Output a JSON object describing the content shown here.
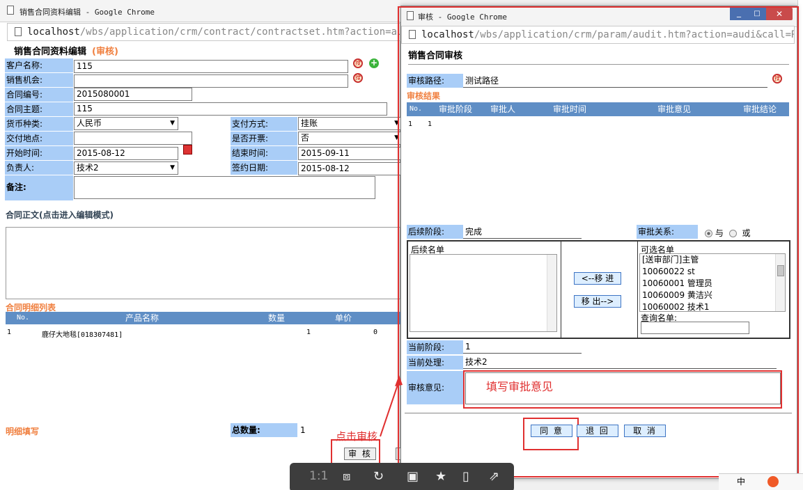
{
  "left_window": {
    "title": "销售合同资料编辑 - Google Chrome",
    "address": "localhost/wbs/application/crm/contract/contractset.htm?action=audi&",
    "address_domain": "localhost",
    "address_path": "/wbs/application/crm/contract/contractset.htm?action=audi&",
    "page_title": "销售合同资料编辑",
    "page_tag": "(审核)",
    "fields": {
      "customer_label": "客户名称:",
      "customer_value": "115",
      "opportunity_label": "销售机会:",
      "opportunity_value": "",
      "contract_no_label": "合同编号:",
      "contract_no_value": "2015080001",
      "subject_label": "合同主题:",
      "subject_value": "115",
      "currency_label": "货币种类:",
      "currency_value": "人民币",
      "payment_label": "支付方式:",
      "payment_value": "挂账",
      "delivery_label": "交付地点:",
      "delivery_value": "",
      "invoice_label": "是否开票:",
      "invoice_value": "否",
      "start_label": "开始时间:",
      "start_value": "2015-08-12",
      "end_label": "结束时间:",
      "end_value": "2015-09-11",
      "owner_label": "负责人:",
      "owner_value": "技术2",
      "sign_label": "签约日期:",
      "sign_value": "2015-08-12",
      "remark_label": "备注:",
      "remark_value": ""
    },
    "body_section": "合同正文(点击进入编辑模式)",
    "detail_section": "合同明细列表",
    "detail_columns": [
      "No.",
      "产品名称",
      "数量",
      "单价"
    ],
    "detail_rows": [
      [
        "1",
        "鹿仔大地毯[018307481]",
        "1",
        "0"
      ]
    ],
    "detail_fill_label": "明细填写",
    "total_qty_label": "总数量:",
    "total_qty_value": "1",
    "audit_button": "审 核",
    "annotation_click": "点击审核"
  },
  "right_window": {
    "title": "审核 - Google Chrome",
    "address_domain": "localhost",
    "address_path": "/wbs/application/crm/param/audit.htm?action=audi&call=Rout",
    "page_title": "销售合同审核",
    "audit_path_label": "审核路径:",
    "audit_path_value": "测试路径",
    "result_section": "审核结果",
    "result_columns": [
      "No.",
      "审批阶段",
      "审批人",
      "审批时间",
      "审批意见",
      "审批结论"
    ],
    "result_rows": [
      [
        "1",
        "1",
        "",
        "",
        "",
        ""
      ]
    ],
    "next_stage_label": "后续阶段:",
    "next_stage_value": "完成",
    "relation_label": "审批关系:",
    "relation_and": "与",
    "relation_or": "或",
    "follow_list_label": "后续名单",
    "move_in_button": "<--移 进",
    "move_out_button": "移 出-->",
    "candidates_label": "可选名单",
    "candidates": [
      "[送审部门]主管",
      "10060022 st",
      "10060001 管理员",
      "10060009 黄洁兴",
      "10060002 技术1"
    ],
    "query_label": "查询名单:",
    "current_stage_label": "当前阶段:",
    "current_stage_value": "1",
    "current_handler_label": "当前处理:",
    "current_handler_value": "技术2",
    "opinion_label": "审核意见:",
    "opinion_annotation": "填写审批意见",
    "agree_button": "同 意",
    "return_button": "退 回",
    "cancel_button": "取 消"
  },
  "viewer_toolbar": {
    "zoom_label": "1:1"
  },
  "tray": {
    "ime_label": "中"
  },
  "colors": {
    "label_bg": "#a9cdf7",
    "table_header": "#5f8ec5",
    "annotation_red": "#e03030",
    "section_orange": "#f08040"
  }
}
